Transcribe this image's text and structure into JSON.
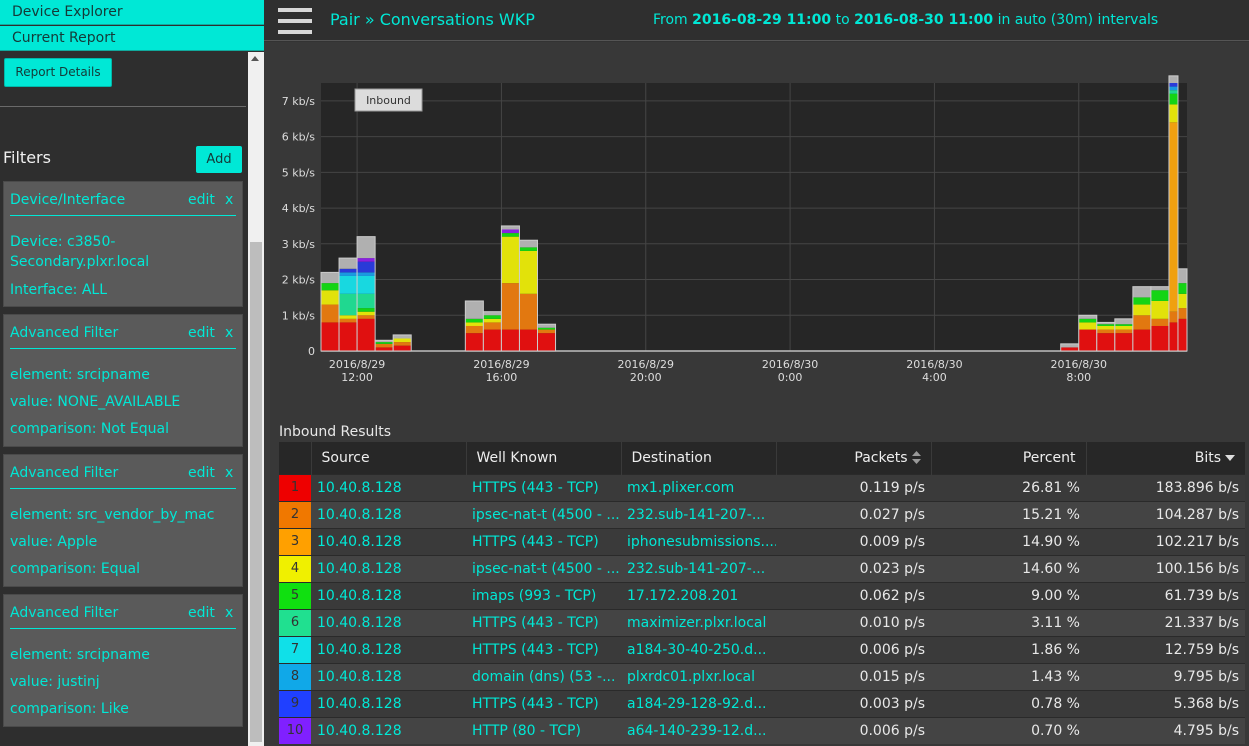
{
  "nav": {
    "device_explorer": "Device Explorer",
    "current_report": "Current Report"
  },
  "sidebar": {
    "report_details": "Report Details",
    "filters_title": "Filters",
    "add_label": "Add",
    "filters": [
      {
        "title": "Device/Interface",
        "edit": "edit",
        "remove": "x",
        "lines": [
          "Device: c3850-",
          "Secondary.plxr.local",
          "Interface: ALL"
        ]
      },
      {
        "title": "Advanced Filter",
        "edit": "edit",
        "remove": "x",
        "lines": [
          "element: srcipname",
          "value: NONE_AVAILABLE",
          "comparison: Not Equal"
        ]
      },
      {
        "title": "Advanced Filter",
        "edit": "edit",
        "remove": "x",
        "lines": [
          "element: src_vendor_by_mac",
          "value: Apple",
          "comparison: Equal"
        ]
      },
      {
        "title": "Advanced Filter",
        "edit": "edit",
        "remove": "x",
        "lines": [
          "element: srcipname",
          "value: justinj",
          "comparison: Like"
        ]
      }
    ]
  },
  "header": {
    "title": "Pair » Conversations WKP",
    "from_label": "From",
    "from": "2016-08-29 11:00",
    "to_label": "to",
    "to": "2016-08-30 11:00",
    "interval": "in auto (30m) intervals"
  },
  "chart_data": {
    "type": "area",
    "legend_label": "Inbound",
    "y_tick_labels": [
      "0",
      "1 kb/s",
      "2 kb/s",
      "3 kb/s",
      "4 kb/s",
      "5 kb/s",
      "6 kb/s",
      "7 kb/s"
    ],
    "ylim": [
      0,
      7.5
    ],
    "x_tick_labels": [
      [
        "2016/8/29",
        "12:00"
      ],
      [
        "2016/8/29",
        "16:00"
      ],
      [
        "2016/8/29",
        "20:00"
      ],
      [
        "2016/8/30",
        "0:00"
      ],
      [
        "2016/8/30",
        "4:00"
      ],
      [
        "2016/8/30",
        "8:00"
      ]
    ],
    "x_range_hours": [
      11,
      35
    ],
    "colors": [
      "#e01010",
      "#e27810",
      "#f0a010",
      "#e2e20a",
      "#14d414",
      "#20d890",
      "#18d8e0",
      "#1a9ae0",
      "#2a3ad8",
      "#8a20e0",
      "#b0b0b0"
    ],
    "stacks": [
      {
        "start": 11.0,
        "end": 11.5,
        "values": [
          0.8,
          0.5,
          0,
          0.4,
          0.2,
          0,
          0,
          0,
          0,
          0,
          0.3
        ]
      },
      {
        "start": 11.5,
        "end": 12.0,
        "values": [
          0.8,
          0.1,
          0,
          0.1,
          0,
          0.6,
          0.5,
          0.1,
          0.1,
          0,
          0.3
        ]
      },
      {
        "start": 12.0,
        "end": 12.5,
        "values": [
          0.9,
          0.1,
          0,
          0.1,
          0.1,
          0.4,
          0.5,
          0.1,
          0.3,
          0.1,
          0.6
        ]
      },
      {
        "start": 12.5,
        "end": 13.0,
        "values": [
          0.1,
          0.1,
          0,
          0,
          0.05,
          0,
          0,
          0,
          0,
          0,
          0.05
        ]
      },
      {
        "start": 13.0,
        "end": 13.5,
        "values": [
          0.15,
          0.1,
          0,
          0.1,
          0,
          0,
          0,
          0,
          0,
          0,
          0.1
        ]
      },
      {
        "start": 15.0,
        "end": 15.5,
        "values": [
          0.5,
          0.2,
          0,
          0.1,
          0.1,
          0,
          0,
          0,
          0,
          0,
          0.5
        ]
      },
      {
        "start": 15.5,
        "end": 16.0,
        "values": [
          0.6,
          0.2,
          0,
          0.1,
          0.1,
          0,
          0,
          0,
          0,
          0,
          0.1
        ]
      },
      {
        "start": 16.0,
        "end": 16.5,
        "values": [
          0.6,
          1.3,
          0,
          1.3,
          0.1,
          0,
          0,
          0,
          0,
          0.1,
          0.1
        ]
      },
      {
        "start": 16.5,
        "end": 17.0,
        "values": [
          0.6,
          1.0,
          0,
          1.2,
          0.1,
          0,
          0,
          0,
          0,
          0,
          0.2
        ]
      },
      {
        "start": 17.0,
        "end": 17.5,
        "values": [
          0.5,
          0.1,
          0,
          0,
          0.05,
          0,
          0,
          0,
          0,
          0,
          0.1
        ]
      },
      {
        "start": 31.5,
        "end": 32.0,
        "values": [
          0.1,
          0,
          0,
          0,
          0,
          0,
          0,
          0,
          0,
          0,
          0.1
        ]
      },
      {
        "start": 32.0,
        "end": 32.5,
        "values": [
          0.6,
          0,
          0,
          0.2,
          0.1,
          0,
          0,
          0,
          0,
          0,
          0.1
        ]
      },
      {
        "start": 32.5,
        "end": 33.0,
        "values": [
          0.5,
          0.1,
          0,
          0.1,
          0.05,
          0,
          0,
          0,
          0,
          0,
          0.05
        ]
      },
      {
        "start": 33.0,
        "end": 33.5,
        "values": [
          0.5,
          0.1,
          0,
          0.1,
          0.05,
          0,
          0,
          0,
          0,
          0,
          0.15
        ]
      },
      {
        "start": 33.5,
        "end": 34.0,
        "values": [
          0.6,
          0.4,
          0,
          0.3,
          0.2,
          0,
          0,
          0,
          0,
          0,
          0.3
        ]
      },
      {
        "start": 34.0,
        "end": 34.5,
        "values": [
          0.7,
          0.2,
          0,
          0.5,
          0.3,
          0,
          0,
          0,
          0,
          0,
          0.1
        ]
      },
      {
        "start": 34.5,
        "end": 34.75,
        "values": [
          0.8,
          0.3,
          5.3,
          0.5,
          0.3,
          0.1,
          0,
          0.1,
          0.1,
          0,
          0.2
        ]
      },
      {
        "start": 34.75,
        "end": 35.0,
        "values": [
          0.9,
          0.3,
          0,
          0.4,
          0.3,
          0,
          0,
          0,
          0,
          0,
          0.4
        ]
      }
    ]
  },
  "results": {
    "label": "Inbound Results",
    "columns": [
      "Source",
      "Well Known",
      "Destination",
      "Packets",
      "Percent",
      "Bits"
    ],
    "rank_colors": [
      "#ee0000",
      "#f07800",
      "#ffa000",
      "#f0f000",
      "#10e010",
      "#20e090",
      "#10e0e8",
      "#10a8e8",
      "#2040ff",
      "#8020ff"
    ],
    "rows": [
      {
        "rank": "1",
        "source": "10.40.8.128",
        "well_known": "HTTPS (443 - TCP)",
        "destination": "mx1.plixer.com",
        "packets": "0.119 p/s",
        "percent": "26.81 %",
        "bits": "183.896 b/s"
      },
      {
        "rank": "2",
        "source": "10.40.8.128",
        "well_known": "ipsec-nat-t (4500 - ...",
        "destination": "232.sub-141-207-...",
        "packets": "0.027 p/s",
        "percent": "15.21 %",
        "bits": "104.287 b/s"
      },
      {
        "rank": "3",
        "source": "10.40.8.128",
        "well_known": "HTTPS (443 - TCP)",
        "destination": "iphonesubmissions....",
        "packets": "0.009 p/s",
        "percent": "14.90 %",
        "bits": "102.217 b/s"
      },
      {
        "rank": "4",
        "source": "10.40.8.128",
        "well_known": "ipsec-nat-t (4500 - ...",
        "destination": "232.sub-141-207-...",
        "packets": "0.023 p/s",
        "percent": "14.60 %",
        "bits": "100.156 b/s"
      },
      {
        "rank": "5",
        "source": "10.40.8.128",
        "well_known": "imaps (993 - TCP)",
        "destination": "17.172.208.201",
        "packets": "0.062 p/s",
        "percent": "9.00 %",
        "bits": "61.739 b/s"
      },
      {
        "rank": "6",
        "source": "10.40.8.128",
        "well_known": "HTTPS (443 - TCP)",
        "destination": "maximizer.plxr.local",
        "packets": "0.010 p/s",
        "percent": "3.11 %",
        "bits": "21.337 b/s"
      },
      {
        "rank": "7",
        "source": "10.40.8.128",
        "well_known": "HTTPS (443 - TCP)",
        "destination": "a184-30-40-250.d...",
        "packets": "0.006 p/s",
        "percent": "1.86 %",
        "bits": "12.759 b/s"
      },
      {
        "rank": "8",
        "source": "10.40.8.128",
        "well_known": "domain (dns) (53 -...",
        "destination": "plxrdc01.plxr.local",
        "packets": "0.015 p/s",
        "percent": "1.43 %",
        "bits": "9.795 b/s"
      },
      {
        "rank": "9",
        "source": "10.40.8.128",
        "well_known": "HTTPS (443 - TCP)",
        "destination": "a184-29-128-92.d...",
        "packets": "0.003 p/s",
        "percent": "0.78 %",
        "bits": "5.368 b/s"
      },
      {
        "rank": "10",
        "source": "10.40.8.128",
        "well_known": "HTTP (80 - TCP)",
        "destination": "a64-140-239-12.d...",
        "packets": "0.006 p/s",
        "percent": "0.70 %",
        "bits": "4.795 b/s"
      }
    ]
  }
}
